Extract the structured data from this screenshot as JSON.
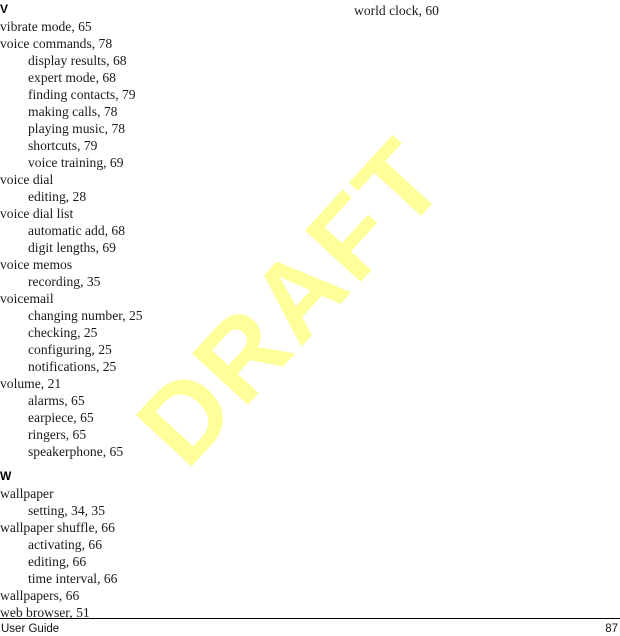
{
  "document": {
    "type": "index-page",
    "watermark_text": "DRAFT",
    "watermark_color": "#ffff99",
    "text_color": "#1a1a1a"
  },
  "columns": [
    {
      "id": "left",
      "groups": [
        {
          "heading": "V",
          "entries": [
            {
              "level": 1,
              "text": "vibrate mode, 65"
            },
            {
              "level": 1,
              "text": "voice commands, 78"
            },
            {
              "level": 2,
              "text": "display results, 68"
            },
            {
              "level": 2,
              "text": "expert mode, 68"
            },
            {
              "level": 2,
              "text": "finding contacts, 79"
            },
            {
              "level": 2,
              "text": "making calls, 78"
            },
            {
              "level": 2,
              "text": "playing music, 78"
            },
            {
              "level": 2,
              "text": "shortcuts, 79"
            },
            {
              "level": 2,
              "text": "voice training, 69"
            },
            {
              "level": 1,
              "text": "voice dial"
            },
            {
              "level": 2,
              "text": "editing, 28"
            },
            {
              "level": 1,
              "text": "voice dial list"
            },
            {
              "level": 2,
              "text": "automatic add, 68"
            },
            {
              "level": 2,
              "text": "digit lengths, 69"
            },
            {
              "level": 1,
              "text": "voice memos"
            },
            {
              "level": 2,
              "text": "recording, 35"
            },
            {
              "level": 1,
              "text": "voicemail"
            },
            {
              "level": 2,
              "text": "changing number, 25"
            },
            {
              "level": 2,
              "text": "checking, 25"
            },
            {
              "level": 2,
              "text": "configuring, 25"
            },
            {
              "level": 2,
              "text": "notifications, 25"
            },
            {
              "level": 1,
              "text": "volume, 21"
            },
            {
              "level": 2,
              "text": "alarms, 65"
            },
            {
              "level": 2,
              "text": "earpiece, 65"
            },
            {
              "level": 2,
              "text": "ringers, 65"
            },
            {
              "level": 2,
              "text": "speakerphone, 65"
            }
          ]
        },
        {
          "heading": "W",
          "entries": [
            {
              "level": 1,
              "text": "wallpaper"
            },
            {
              "level": 2,
              "text": "setting, 34, 35"
            },
            {
              "level": 1,
              "text": "wallpaper shuffle, 66"
            },
            {
              "level": 2,
              "text": "activating, 66"
            },
            {
              "level": 2,
              "text": "editing, 66"
            },
            {
              "level": 2,
              "text": "time interval, 66"
            },
            {
              "level": 1,
              "text": "wallpapers, 66"
            },
            {
              "level": 1,
              "text": "web browser, 51"
            }
          ]
        }
      ]
    },
    {
      "id": "right",
      "groups": [
        {
          "heading": "",
          "entries": [
            {
              "level": 2,
              "text": "world clock, 60"
            }
          ]
        }
      ]
    }
  ],
  "footer": {
    "label": "User Guide",
    "page_number": "87"
  }
}
